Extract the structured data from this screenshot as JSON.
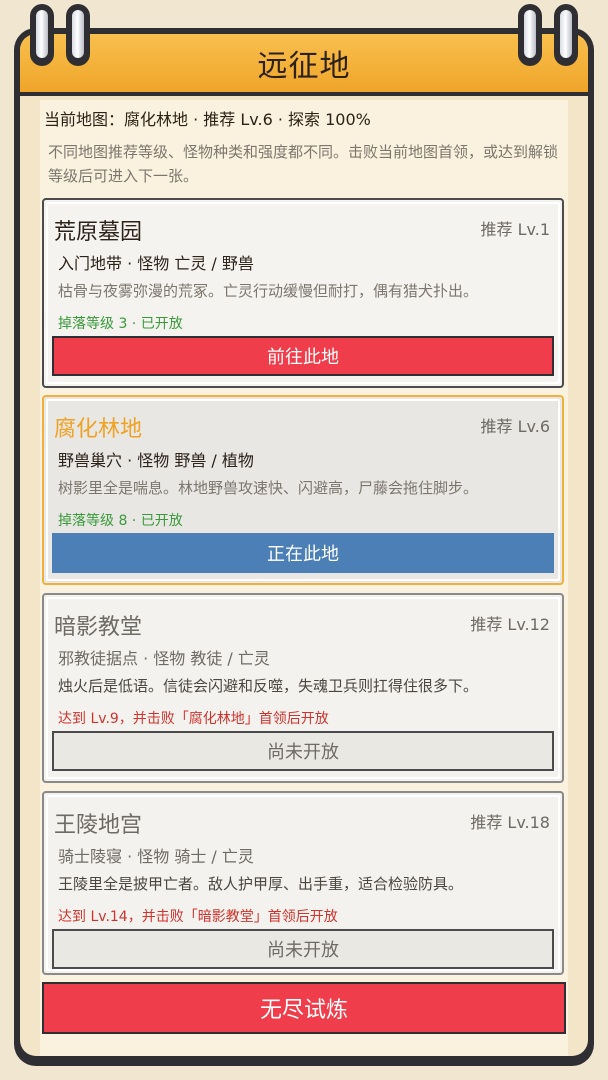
{
  "header": {
    "title": "远征地"
  },
  "current": {
    "line": "当前地图：腐化林地  ·  推荐 Lv.6  ·  探索 100%"
  },
  "description": "不同地图推荐等级、怪物种类和强度都不同。击败当前地图首领，或达到解锁等级后可进入下一张。",
  "maps": [
    {
      "name": "荒原墓园",
      "recommend": "推荐 Lv.1",
      "meta": "入门地带  ·  怪物 亡灵 / 野兽",
      "text": "枯骨与夜雾弥漫的荒冢。亡灵行动缓慢但耐打，偶有猎犬扑出。",
      "status": "掉落等级 3  ·  已开放",
      "button": "前往此地"
    },
    {
      "name": "腐化林地",
      "recommend": "推荐 Lv.6",
      "meta": "野兽巢穴  ·  怪物 野兽 / 植物",
      "text": "树影里全是喘息。林地野兽攻速快、闪避高，尸藤会拖住脚步。",
      "status": "掉落等级 8  ·  已开放",
      "button": "正在此地"
    },
    {
      "name": "暗影教堂",
      "recommend": "推荐 Lv.12",
      "meta": "邪教徒据点  ·  怪物 教徒 / 亡灵",
      "text": "烛火后是低语。信徒会闪避和反噬，失魂卫兵则扛得住很多下。",
      "status": "达到 Lv.9，并击败「腐化林地」首领后开放",
      "button": "尚未开放"
    },
    {
      "name": "王陵地宫",
      "recommend": "推荐 Lv.18",
      "meta": "骑士陵寝  ·  怪物 骑士 / 亡灵",
      "text": "王陵里全是披甲亡者。敌人护甲厚、出手重，适合检验防具。",
      "status": "达到 Lv.14，并击败「暗影教堂」首领后开放",
      "button": "尚未开放"
    }
  ],
  "endless_button": "无尽试炼",
  "colors": {
    "accent": "#f0a52a",
    "red": "#ef3d4b",
    "blue": "#4b7fb6",
    "green": "#3b9a3b",
    "warning": "#d2332e"
  }
}
